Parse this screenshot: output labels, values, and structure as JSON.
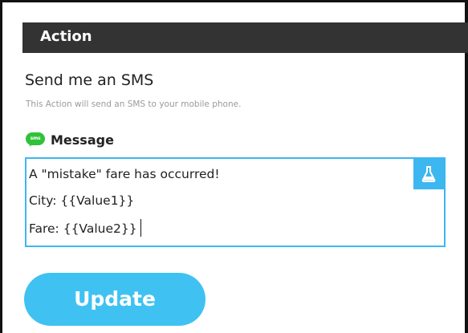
{
  "header": {
    "title": "Action"
  },
  "action": {
    "name": "Send me an SMS",
    "description": "This Action will send an SMS to your mobile phone."
  },
  "message_field": {
    "label": "Message",
    "icon": "sms-icon",
    "icon_text": "sms",
    "lines": [
      "A \"mistake\" fare has occurred!",
      "City: {{Value1}}",
      "Fare: {{Value2}}"
    ],
    "ingredient_icon": "flask-icon"
  },
  "update_button": {
    "label": "Update"
  },
  "colors": {
    "header_bg": "#333333",
    "accent": "#3db7f0",
    "sms_green": "#2fc23a"
  }
}
